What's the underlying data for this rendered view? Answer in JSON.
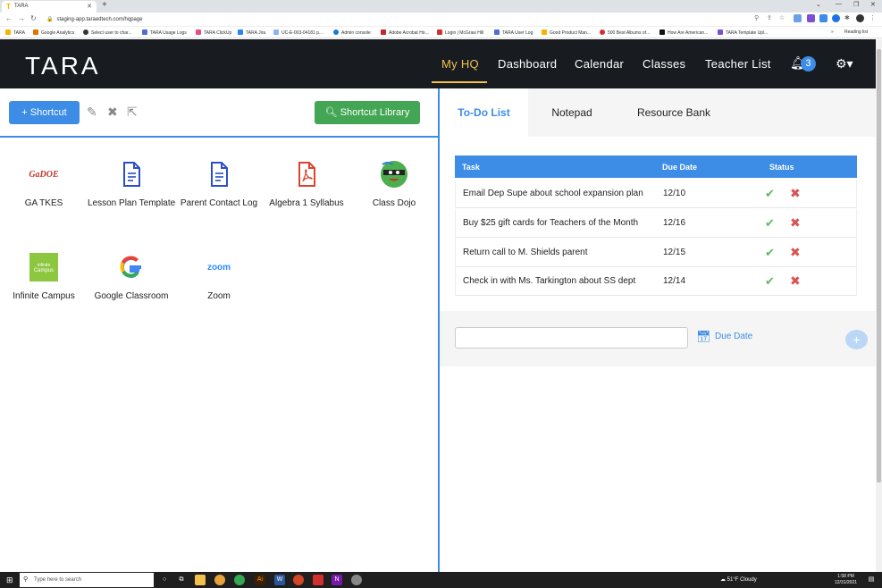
{
  "browser": {
    "tab_title": "TARA",
    "url": "staging-app.taraedtech.com/hqpage"
  },
  "bookmarks": [
    "TARA",
    "Google Analytics",
    "Select user to char...",
    "TARA Usage Logs",
    "TARA ClickUp",
    "TARA Jira",
    "UC-E-003-04181 p...",
    "Admin console",
    "Adobe Acrobat Ho...",
    "Login | McGraw Hill",
    "TARA User Log",
    "Good Product Man...",
    "500 Best Albums of...",
    "How Are American...",
    "TARA Template Upl...",
    "Reading list"
  ],
  "app": {
    "logo": "TARA",
    "nav": [
      "My HQ",
      "Dashboard",
      "Calendar",
      "Classes",
      "Teacher List"
    ],
    "notification_count": "3",
    "colors": {
      "header_bg": "#181c21",
      "active_nav": "#f2c14e",
      "accent": "#3d8de6"
    }
  },
  "shortcuts": {
    "add_label": "+ Shortcut",
    "library_label": "🔍︎ Shortcut Library",
    "items": [
      {
        "label": "GA TKES",
        "icon": "ga-doe-logo"
      },
      {
        "label": "Lesson Plan Template",
        "icon": "document"
      },
      {
        "label": "Parent Contact Log",
        "icon": "document"
      },
      {
        "label": "Algebra 1 Syllabus",
        "icon": "pdf"
      },
      {
        "label": "Class Dojo",
        "icon": "class-dojo-monster"
      },
      {
        "label": "Infinite Campus",
        "icon": "infinite-campus-logo"
      },
      {
        "label": "Google Classroom",
        "icon": "google-g"
      },
      {
        "label": "Zoom",
        "icon": "zoom-logo"
      }
    ]
  },
  "right_panel": {
    "tabs": [
      "To-Do List",
      "Notepad",
      "Resource Bank"
    ],
    "active_tab": "To-Do List"
  },
  "todo": {
    "columns": [
      "Task",
      "Due Date",
      "Status"
    ],
    "rows": [
      {
        "task": "Email Dep Supe about school expansion plan",
        "due": "12/10"
      },
      {
        "task": "Buy $25 gift cards for Teachers of the Month",
        "due": "12/16"
      },
      {
        "task": "Return call to M. Shields parent",
        "due": "12/15"
      },
      {
        "task": "Check in with Ms. Tarkington about SS dept",
        "due": "12/14"
      }
    ],
    "new_task_value": "",
    "due_date_label": "Due Date"
  },
  "taskbar": {
    "search_placeholder": "Type here to search",
    "weather": "51°F Cloudy",
    "time": "1:58 PM",
    "date": "12/31/2021"
  }
}
